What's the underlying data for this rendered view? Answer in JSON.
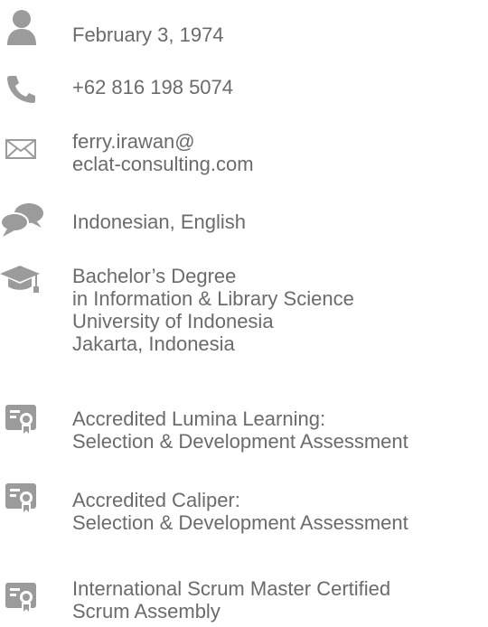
{
  "colors": {
    "icon": "#9b9b9b",
    "text": "#6b6b6b"
  },
  "items": [
    {
      "icon": "person-icon",
      "lines": [
        "February 3, 1974"
      ]
    },
    {
      "icon": "phone-icon",
      "lines": [
        "+62 816 198 5074"
      ]
    },
    {
      "icon": "envelope-icon",
      "lines": [
        "ferry.irawan@",
        "eclat-consulting.com"
      ]
    },
    {
      "icon": "speech-bubbles-icon",
      "lines": [
        "Indonesian, English"
      ]
    },
    {
      "icon": "graduation-cap-icon",
      "lines": [
        "Bachelor’s Degree",
        "in Information & Library Science",
        "University of Indonesia",
        "Jakarta, Indonesia"
      ]
    },
    {
      "icon": "certificate-icon",
      "lines": [
        "Accredited Lumina Learning:",
        "Selection & Development Assessment"
      ]
    },
    {
      "icon": "certificate-icon",
      "lines": [
        "Accredited Caliper:",
        "Selection & Development Assessment"
      ]
    },
    {
      "icon": "certificate-icon",
      "lines": [
        "International Scrum Master Certified",
        "Scrum Assembly"
      ]
    }
  ]
}
